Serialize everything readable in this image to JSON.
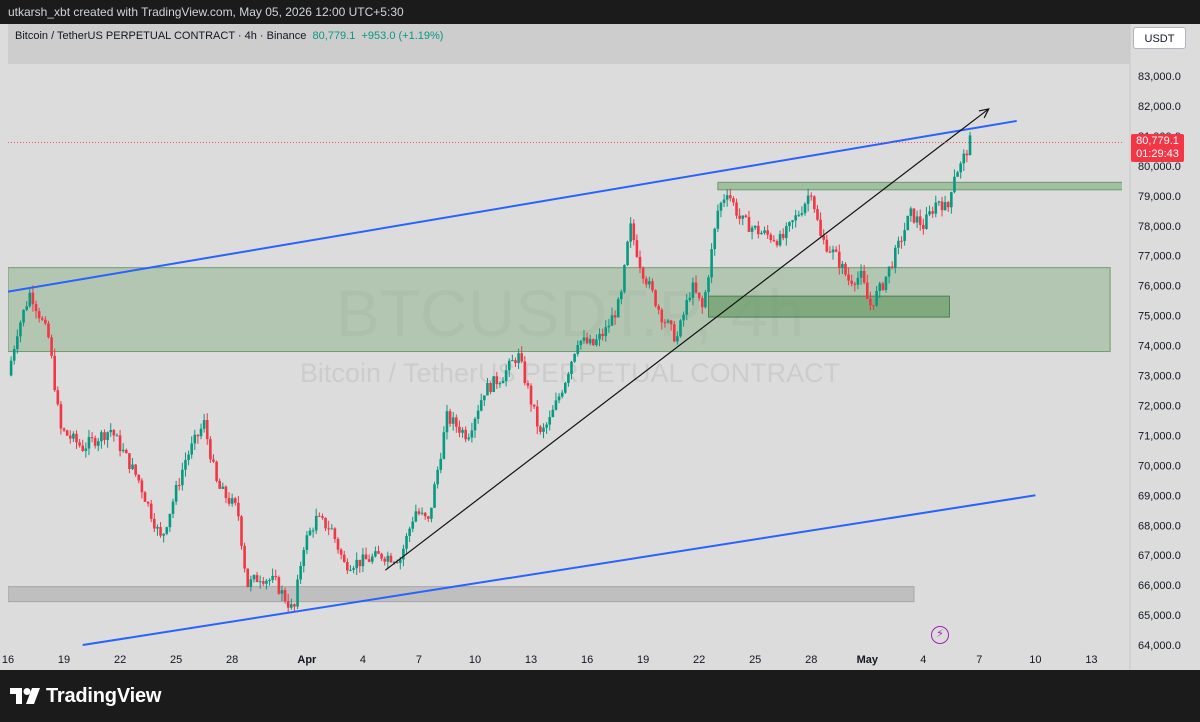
{
  "header": {
    "attribution": "utkarsh_xbt created with TradingView.com, May 05, 2026 12:00 UTC+5:30"
  },
  "symbol": {
    "name": "Bitcoin / TetherUS PERPETUAL CONTRACT · 4h · Binance",
    "last_price": "80,779.1",
    "change": "+953.0 (+1.19%)",
    "currency_button": "USDT",
    "countdown": "01:29:43",
    "watermark_ticker": "BTCUSDT.P, 4h",
    "watermark_desc": "Bitcoin / TetherUS PERPETUAL CONTRACT"
  },
  "brand": {
    "logo_text": "TradingView"
  },
  "colors": {
    "background": "#dcdcdc",
    "up": "#089981",
    "down": "#f23645",
    "trendline": "#2962ff",
    "zone": "#8fb58f",
    "gray_zone": "#b8b8b8"
  },
  "chart_data": {
    "type": "candlestick",
    "timeframe": "4h",
    "ylim": [
      64000,
      83500
    ],
    "y_ticks": [
      "64,000.0",
      "65,000.0",
      "66,000.0",
      "67,000.0",
      "68,000.0",
      "69,000.0",
      "70,000.0",
      "71,000.0",
      "72,000.0",
      "73,000.0",
      "74,000.0",
      "75,000.0",
      "76,000.0",
      "77,000.0",
      "78,000.0",
      "79,000.0",
      "80,000.0",
      "81,000.0",
      "82,000.0",
      "83,000.0"
    ],
    "x_ticks": [
      {
        "label": "16",
        "day": 0
      },
      {
        "label": "19",
        "day": 3
      },
      {
        "label": "22",
        "day": 6
      },
      {
        "label": "25",
        "day": 9
      },
      {
        "label": "28",
        "day": 12
      },
      {
        "label": "Apr",
        "day": 16
      },
      {
        "label": "4",
        "day": 19
      },
      {
        "label": "7",
        "day": 22
      },
      {
        "label": "10",
        "day": 25
      },
      {
        "label": "13",
        "day": 28
      },
      {
        "label": "16",
        "day": 31
      },
      {
        "label": "19",
        "day": 34
      },
      {
        "label": "22",
        "day": 37
      },
      {
        "label": "25",
        "day": 40
      },
      {
        "label": "28",
        "day": 43
      },
      {
        "label": "May",
        "day": 46
      },
      {
        "label": "4",
        "day": 49
      },
      {
        "label": "7",
        "day": 52
      },
      {
        "label": "10",
        "day": 55
      },
      {
        "label": "13",
        "day": 58
      }
    ],
    "price_path": [
      [
        0,
        73000
      ],
      [
        0.5,
        74500
      ],
      [
        1.2,
        75800
      ],
      [
        2.2,
        74200
      ],
      [
        2.8,
        71200
      ],
      [
        4,
        70600
      ],
      [
        5.5,
        71200
      ],
      [
        7,
        69500
      ],
      [
        8.2,
        67500
      ],
      [
        9.5,
        70200
      ],
      [
        10.5,
        71400
      ],
      [
        11.2,
        69300
      ],
      [
        12.3,
        68500
      ],
      [
        12.8,
        66000
      ],
      [
        13.5,
        66300
      ],
      [
        14.3,
        66100
      ],
      [
        15.3,
        65100
      ],
      [
        15.8,
        67300
      ],
      [
        16.5,
        68200
      ],
      [
        17.3,
        67900
      ],
      [
        18,
        66700
      ],
      [
        19,
        66800
      ],
      [
        20,
        67000
      ],
      [
        21,
        66900
      ],
      [
        21.8,
        68500
      ],
      [
        22.5,
        68100
      ],
      [
        23.5,
        71600
      ],
      [
        24.6,
        71000
      ],
      [
        25.5,
        72500
      ],
      [
        26.5,
        73000
      ],
      [
        27.3,
        73700
      ],
      [
        27.8,
        72600
      ],
      [
        28.5,
        71000
      ],
      [
        29,
        71500
      ],
      [
        29.8,
        72800
      ],
      [
        30.5,
        74200
      ],
      [
        31.3,
        74000
      ],
      [
        32,
        74500
      ],
      [
        32.8,
        75500
      ],
      [
        33.3,
        78000
      ],
      [
        33.9,
        76600
      ],
      [
        35,
        75000
      ],
      [
        35.8,
        74200
      ],
      [
        36.6,
        76000
      ],
      [
        37.2,
        75200
      ],
      [
        38,
        78500
      ],
      [
        38.5,
        79200
      ],
      [
        39.2,
        78200
      ],
      [
        40.2,
        77800
      ],
      [
        41.4,
        77500
      ],
      [
        42.5,
        78600
      ],
      [
        43,
        79200
      ],
      [
        43.5,
        77600
      ],
      [
        44.3,
        77000
      ],
      [
        45,
        76200
      ],
      [
        45.7,
        76300
      ],
      [
        46.1,
        75300
      ],
      [
        46.8,
        76000
      ],
      [
        47.6,
        77200
      ],
      [
        48.3,
        78400
      ],
      [
        49,
        78000
      ],
      [
        49.8,
        78900
      ],
      [
        50.3,
        78500
      ],
      [
        50.6,
        79700
      ],
      [
        51,
        80000
      ],
      [
        51.5,
        80800
      ]
    ],
    "drawings": {
      "upper_channel_line": {
        "from": [
          0,
          75800
        ],
        "to": [
          54,
          81500
        ]
      },
      "lower_channel_line": {
        "from": [
          4,
          64000
        ],
        "to": [
          55,
          69000
        ]
      },
      "diagonal_arrow": {
        "from": [
          20.2,
          66500
        ],
        "to": [
          52.5,
          81900
        ]
      },
      "zone_demand": {
        "from_day": 0,
        "to_day": 59,
        "top": 76600,
        "bottom": 73800
      },
      "zone_small": {
        "from_day": 37.5,
        "to_day": 50.4,
        "top": 75650,
        "bottom": 74950
      },
      "zone_resistance": {
        "from_day": 38,
        "to_day": 60.5,
        "top": 79450,
        "bottom": 79200
      },
      "zone_support_gray": {
        "from_day": 0,
        "to_day": 48.5,
        "top": 65950,
        "bottom": 65450
      }
    }
  }
}
